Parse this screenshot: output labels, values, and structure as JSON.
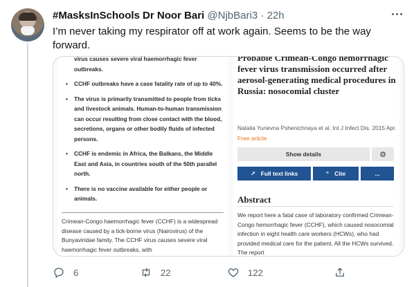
{
  "tweet": {
    "author_name": "#MasksInSchools Dr Noor Bari",
    "handle": "@NjbBari3",
    "separator": "·",
    "time": "22h",
    "text": "I’m never taking my respirator off at work again. Seems to be the way forward."
  },
  "media": {
    "bullets": [
      "virus causes severe viral haemorrhagic fever outbreaks.",
      "CCHF outbreaks have a case fatality rate of up to 40%.",
      "The virus is primarily transmitted to people from ticks and livestock animals. Human-to-human transmission can occur resulting from close contact with the blood, secretions, organs or other bodily fluids of infected persons.",
      "CCHF is endemic in Africa, the Balkans, the Middle East and Asia, in countries south of the 50th parallel north.",
      "There is no vaccine available for either people or animals."
    ],
    "intro": "Crimean-Congo haemorrhagic fever (CCHF) is a widespread disease caused by a tick-borne virus (Nairovirus) of the Bunyaviridae family. The CCHF virus causes severe viral haemorrhagic fever outbreaks, with",
    "article_title": "Probable Crimean-Congo hemorrhagic fever virus transmission occurred after aerosol-generating medical procedures in Russia: nosocomial cluster",
    "authors": "Natalia Yurievna Pshenichnaya et al. Int J Infect Dis. 2015 Apr.",
    "free_label": "Free article",
    "show_details": "Show details",
    "full_text": "Full text links",
    "cite": "Cite",
    "more": "...",
    "abstract_heading": "Abstract",
    "abstract_text": "We report here a fatal case of laboratory confirmed Crimean-Congo hemorrhagic fever (CCHF), which caused nosocomial infection in eight health care workers (HCWs), who had provided medical care for the patient. All the HCWs survived. The report"
  },
  "actions": {
    "replies": "6",
    "retweets": "22",
    "likes": "122"
  },
  "colors": {
    "accent_blue": "#205493",
    "free_orange": "#e9711c",
    "muted": "#536471"
  },
  "icons": [
    "more-icon",
    "reply-icon",
    "retweet-icon",
    "like-icon",
    "share-icon",
    "gear-icon",
    "external-link-icon",
    "quote-icon"
  ]
}
